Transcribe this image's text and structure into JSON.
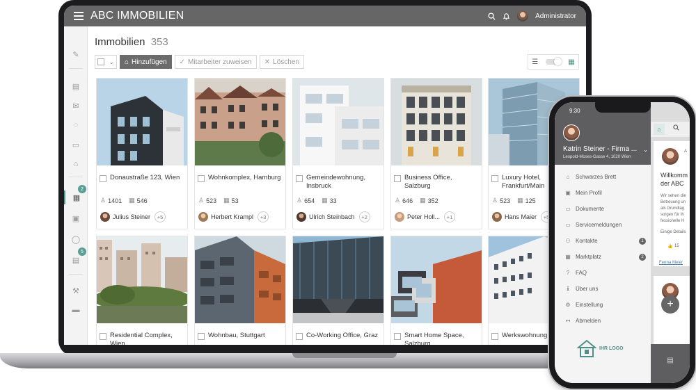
{
  "colors": {
    "topbar": "#666666",
    "accent": "#5a9e95",
    "logo": "#4e8f86"
  },
  "app": {
    "title": "ABC IMMOBILIEN",
    "user": "Administrator"
  },
  "icons": {
    "menu": "hamburger-icon",
    "search": "search-icon",
    "bell": "bell-icon"
  },
  "sidebar": {
    "badges": [
      "2",
      "5"
    ]
  },
  "page": {
    "title": "Immobilien",
    "count": "353"
  },
  "toolbar": {
    "add": "Hinzufügen",
    "assign": "Mitarbeiter zuweisen",
    "delete": "Löschen"
  },
  "properties": [
    {
      "address": "Donaustraße 123, Wien",
      "residents": "1401",
      "units": "546",
      "agent": "Julius Steiner",
      "more": "+5"
    },
    {
      "address": "Wohnkomplex, Hamburg",
      "residents": "523",
      "units": "53",
      "agent": "Herbert Krampl",
      "more": "+3"
    },
    {
      "address": "Gemeindewohnung, Insbruck",
      "residents": "654",
      "units": "33",
      "agent": "Ulrich Steinbach",
      "more": "+2"
    },
    {
      "address": "Business Office, Salzburg",
      "residents": "646",
      "units": "352",
      "agent": "Peter Holl...",
      "more": "+1"
    },
    {
      "address": "Luxury Hotel, Frankfurt/Main",
      "residents": "523",
      "units": "125",
      "agent": "Hans Maier",
      "more": "+5"
    },
    {
      "address": "Residential Complex, Wien"
    },
    {
      "address": "Wohnbau, Stuttgart"
    },
    {
      "address": "Co-Working Office, Graz"
    },
    {
      "address": "Smart Home Space, Salzburg"
    },
    {
      "address": "Werkswohnung, Berlin"
    }
  ],
  "phone": {
    "time": "9:30",
    "user_name": "Katrin Steiner - Firma ...",
    "user_address": "Leopold-Moses-Gasse 4, 1020 Wien",
    "menu": [
      {
        "label": "Schwarzes Brett",
        "badge": ""
      },
      {
        "label": "Mein Profil",
        "badge": ""
      },
      {
        "label": "Dokumente",
        "badge": ""
      },
      {
        "label": "Servicemeldungen",
        "badge": ""
      },
      {
        "label": "Kontakte",
        "badge": "1"
      },
      {
        "label": "Marktplatz",
        "badge": "2"
      },
      {
        "label": "FAQ",
        "badge": ""
      },
      {
        "label": "Über uns",
        "badge": ""
      },
      {
        "label": "Einstellung",
        "badge": ""
      },
      {
        "label": "Abmelden",
        "badge": ""
      }
    ],
    "logo_text": "IHR LOGO",
    "feed": {
      "author_initial": "A",
      "heading_1": "Willkomm",
      "heading_2": "der ABC",
      "lines": [
        "Wir sehen die",
        "Betreuung un",
        "als Grundlag",
        "sorgen für Ih",
        "fessionelle H"
      ],
      "details": "Einige Details",
      "likes": "15",
      "author_link": "Ferma Meier"
    }
  }
}
